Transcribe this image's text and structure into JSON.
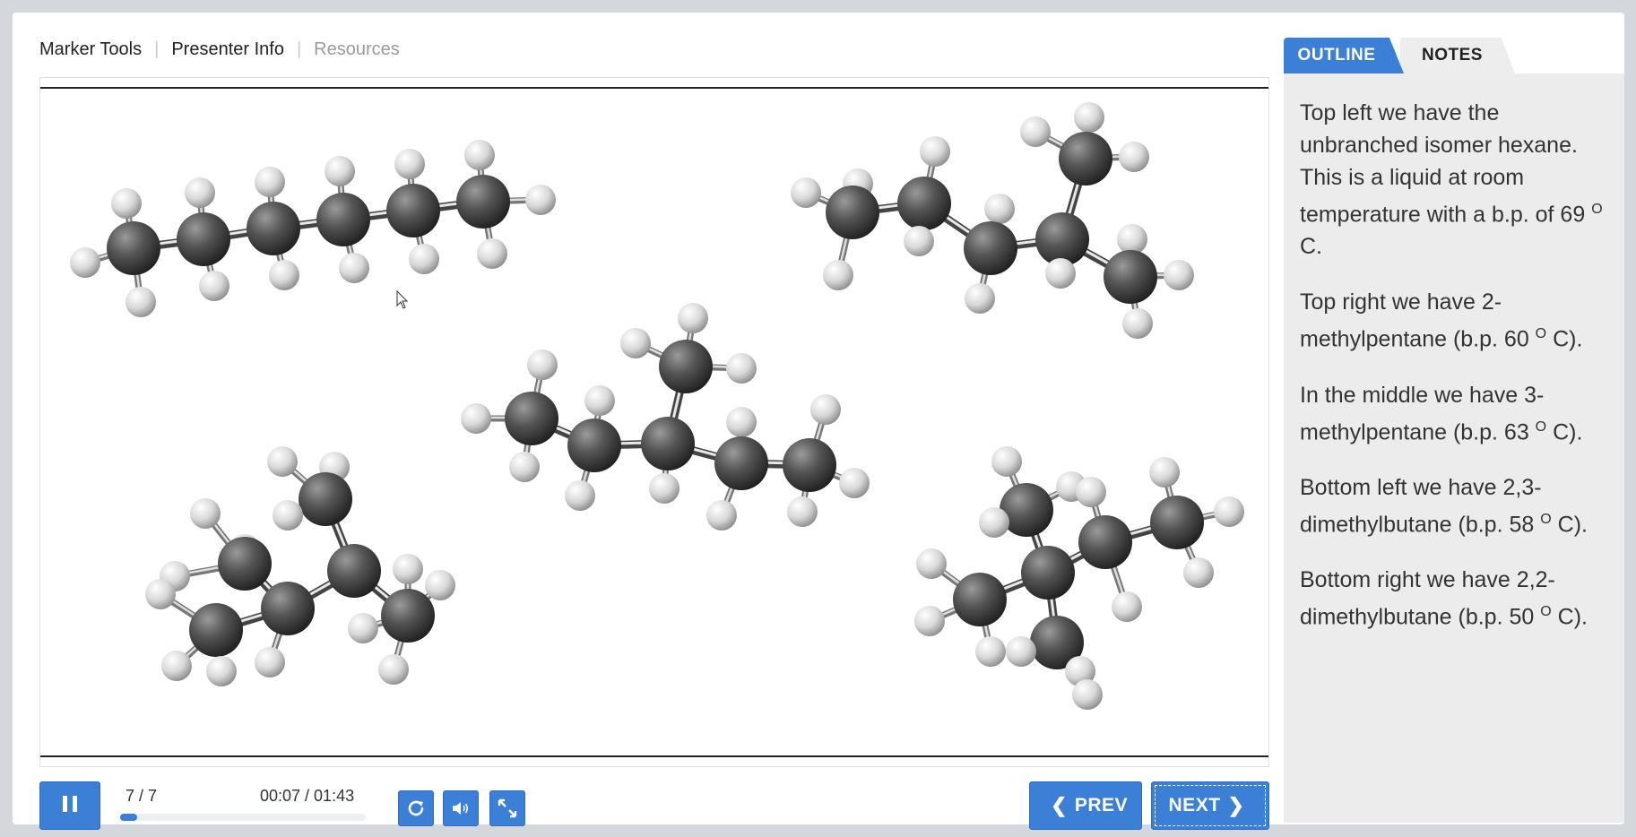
{
  "topnav": {
    "items": [
      "Marker Tools",
      "Presenter Info",
      "Resources"
    ]
  },
  "player": {
    "slide_counter": "7 / 7",
    "time": "00:07 / 01:43",
    "progress_fraction": 0.07,
    "prev_label": "PREV",
    "next_label": "NEXT",
    "accent": "#3b7fd6"
  },
  "sidebar": {
    "tabs": [
      "OUTLINE",
      "NOTES"
    ],
    "active_tab": "OUTLINE",
    "notes": [
      {
        "pre": "Top left we have the unbranched isomer hexane. This is a liquid at room temperature with a b.p. of 69 ",
        "sup": "O",
        "post": " C."
      },
      {
        "pre": "Top right we have 2-methylpentane (b.p. 60 ",
        "sup": "O",
        "post": " C)."
      },
      {
        "pre": "In the middle we have 3-methylpentane (b.p. 63 ",
        "sup": "O",
        "post": " C)."
      },
      {
        "pre": "Bottom left we have 2,3-dimethylbutane (b.p. 58 ",
        "sup": "O",
        "post": " C)."
      },
      {
        "pre": "Bottom right we have 2,2-dimethylbutane (b.p. 50 ",
        "sup": "O",
        "post": " C)."
      }
    ]
  },
  "icons": {
    "pause": "pause-icon",
    "replay": "replay-icon",
    "volume": "volume-icon",
    "fullscreen": "fullscreen-icon",
    "prev": "chevron-left-icon",
    "next": "chevron-right-icon"
  }
}
